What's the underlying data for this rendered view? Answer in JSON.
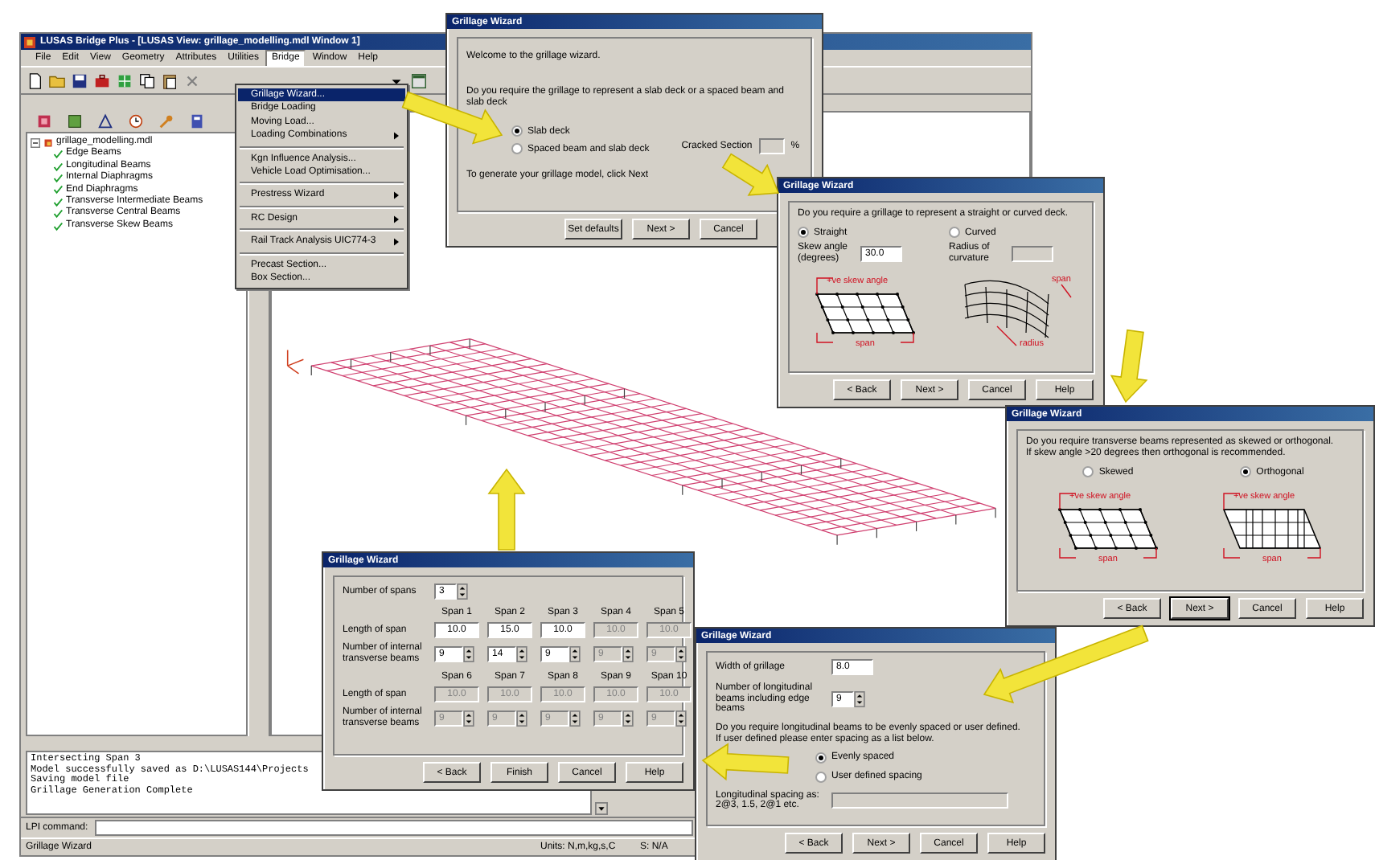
{
  "main_window": {
    "title": "LUSAS Bridge Plus - [LUSAS View: grillage_modelling.mdl Window 1]",
    "menu": [
      {
        "label": "File",
        "selected": false
      },
      {
        "label": "Edit",
        "selected": false
      },
      {
        "label": "View",
        "selected": false
      },
      {
        "label": "Geometry",
        "selected": false
      },
      {
        "label": "Attributes",
        "selected": false
      },
      {
        "label": "Utilities",
        "selected": false
      },
      {
        "label": "Bridge",
        "selected": true
      },
      {
        "label": "Window",
        "selected": false
      },
      {
        "label": "Help",
        "selected": false
      }
    ],
    "tree": {
      "label": "grillage_modelling.mdl",
      "expanded": true,
      "children": [
        {
          "label": "Edge Beams",
          "checked": true
        },
        {
          "label": "Longitudinal Beams",
          "checked": true
        },
        {
          "label": "Internal Diaphragms",
          "checked": true
        },
        {
          "label": "End Diaphragms",
          "checked": true
        },
        {
          "label": "Transverse Intermediate Beams",
          "checked": true
        },
        {
          "label": "Transverse Central Beams",
          "checked": true
        },
        {
          "label": "Transverse Skew Beams",
          "checked": true
        }
      ]
    },
    "console": [
      "Intersecting Span 3",
      "Model successfully saved as D:\\LUSAS144\\Projects",
      "Saving model file",
      "Grillage Generation Complete"
    ],
    "command_label": "LPI command:",
    "status_bar": [
      "Grillage Wizard",
      "Units: N,m,kg,s,C",
      "S: N/A"
    ]
  },
  "bridge_menu": [
    {
      "kind": "item",
      "label": "Grillage Wizard...",
      "selected": true,
      "submenu": false
    },
    {
      "kind": "item",
      "label": "Bridge Loading",
      "selected": false,
      "submenu": false
    },
    {
      "kind": "item",
      "label": "Moving Load...",
      "selected": false,
      "submenu": false
    },
    {
      "kind": "item",
      "label": "Loading Combinations",
      "selected": false,
      "submenu": true
    },
    {
      "kind": "separator"
    },
    {
      "kind": "item",
      "label": "Kgn Influence Analysis...",
      "selected": false,
      "submenu": false
    },
    {
      "kind": "item",
      "label": "Vehicle Load Optimisation...",
      "selected": false,
      "submenu": false
    },
    {
      "kind": "separator"
    },
    {
      "kind": "item",
      "label": "Prestress Wizard",
      "selected": false,
      "submenu": true
    },
    {
      "kind": "separator"
    },
    {
      "kind": "item",
      "label": "RC Design",
      "selected": false,
      "submenu": true
    },
    {
      "kind": "separator"
    },
    {
      "kind": "item",
      "label": "Rail Track Analysis UIC774-3",
      "selected": false,
      "submenu": true
    },
    {
      "kind": "separator"
    },
    {
      "kind": "item",
      "label": "Precast Section...",
      "selected": false,
      "submenu": false
    },
    {
      "kind": "item",
      "label": "Box Section...",
      "selected": false,
      "submenu": false
    }
  ],
  "deck_type_wizard": {
    "title": "Grillage Wizard",
    "welcome": "Welcome to the grillage wizard.",
    "question": "Do you require the grillage to represent a slab deck or a spaced beam and slab deck",
    "options": [
      {
        "label": "Slab deck",
        "selected": true
      },
      {
        "label": "Spaced beam and slab deck",
        "selected": false
      }
    ],
    "cracked_section": {
      "label": "Cracked Section",
      "unit": "%",
      "disabled": true
    },
    "instruction": "To generate your grillage model, click Next",
    "buttons": [
      {
        "label": "Set defaults",
        "focused": false
      },
      {
        "label": "Next >",
        "focused": false
      },
      {
        "label": "Cancel",
        "focused": false
      }
    ]
  },
  "alignment_wizard": {
    "title": "Grillage Wizard",
    "question": "Do you require a grillage to represent a straight or curved deck.",
    "options": [
      {
        "label": "Straight",
        "selected": true
      },
      {
        "label": "Curved",
        "selected": false
      }
    ],
    "skew_angle": {
      "label": "Skew angle (degrees)",
      "value": "30.0",
      "disabled": false
    },
    "radius": {
      "label": "Radius of curvature",
      "disabled": true
    },
    "diagrams": [
      {
        "kind": "straight",
        "labels": [
          "+ve skew angle",
          "span"
        ]
      },
      {
        "kind": "curved",
        "labels": [
          "span",
          "radius"
        ]
      }
    ],
    "buttons": [
      {
        "label": "< Back",
        "focused": false
      },
      {
        "label": "Next >",
        "focused": false
      },
      {
        "label": "Cancel",
        "focused": false
      },
      {
        "label": "Help",
        "focused": false
      }
    ]
  },
  "transverse_wizard": {
    "title": "Grillage Wizard",
    "question": [
      "Do you require transverse beams represented as skewed or orthogonal.",
      "If skew angle >20 degrees then orthogonal is recommended."
    ],
    "options": [
      {
        "label": "Skewed",
        "selected": false,
        "diagram": {
          "kind": "skewed",
          "labels": [
            "+ve skew angle",
            "span"
          ]
        }
      },
      {
        "label": "Orthogonal",
        "selected": true,
        "diagram": {
          "kind": "orthogonal",
          "labels": [
            "+ve skew angle",
            "span"
          ]
        }
      }
    ],
    "buttons": [
      {
        "label": "< Back",
        "focused": false
      },
      {
        "label": "Next >",
        "focused": true
      },
      {
        "label": "Cancel",
        "focused": false
      },
      {
        "label": "Help",
        "focused": false
      }
    ]
  },
  "spans_wizard": {
    "title": "Grillage Wizard",
    "spans_label": "Number of spans",
    "spans_value": "3",
    "groups": [
      {
        "length_label": "Length of span",
        "beams_label": "Number of internal transverse beams",
        "spans": [
          {
            "name": "Span 1",
            "length": "10.0",
            "beams": "9",
            "disabled": false
          },
          {
            "name": "Span 2",
            "length": "15.0",
            "beams": "14",
            "disabled": false
          },
          {
            "name": "Span 3",
            "length": "10.0",
            "beams": "9",
            "disabled": false
          },
          {
            "name": "Span 4",
            "length": "10.0",
            "beams": "9",
            "disabled": true
          },
          {
            "name": "Span 5",
            "length": "10.0",
            "beams": "9",
            "disabled": true
          }
        ]
      },
      {
        "length_label": "Length of span",
        "beams_label": "Number of internal transverse beams",
        "spans": [
          {
            "name": "Span 6",
            "length": "10.0",
            "beams": "9",
            "disabled": true
          },
          {
            "name": "Span 7",
            "length": "10.0",
            "beams": "9",
            "disabled": true
          },
          {
            "name": "Span 8",
            "length": "10.0",
            "beams": "9",
            "disabled": true
          },
          {
            "name": "Span 9",
            "length": "10.0",
            "beams": "9",
            "disabled": true
          },
          {
            "name": "Span 10",
            "length": "10.0",
            "beams": "9",
            "disabled": true
          }
        ]
      }
    ],
    "buttons": [
      {
        "label": "< Back",
        "focused": false
      },
      {
        "label": "Finish",
        "focused": false
      },
      {
        "label": "Cancel",
        "focused": false
      },
      {
        "label": "Help",
        "focused": false
      }
    ]
  },
  "longitudinal_wizard": {
    "title": "Grillage Wizard",
    "width_label": "Width of grillage",
    "width_value": "8.0",
    "beams_label": "Number of longitudinal beams including edge beams",
    "beams_value": "9",
    "question": [
      "Do you require longitudinal beams to be evenly spaced or user defined.",
      "If user defined please enter spacing as a list below."
    ],
    "options": [
      {
        "label": "Evenly spaced",
        "selected": true
      },
      {
        "label": "User defined spacing",
        "selected": false
      }
    ],
    "spacing_label": "Longitudinal spacing as: 2@3, 1.5, 2@1 etc.",
    "spacing_disabled": true,
    "buttons": [
      {
        "label": "< Back",
        "focused": false
      },
      {
        "label": "Next >",
        "focused": false
      },
      {
        "label": "Cancel",
        "focused": false
      },
      {
        "label": "Help",
        "focused": false
      }
    ]
  }
}
